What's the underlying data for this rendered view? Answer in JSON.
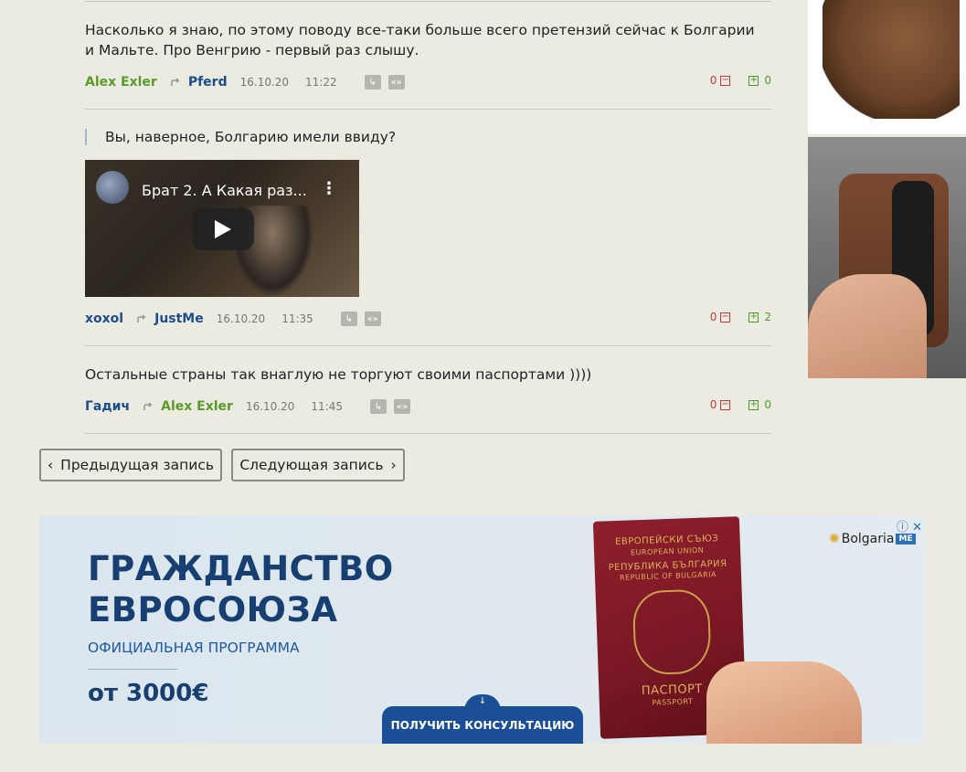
{
  "comments": [
    {
      "text": "Насколько я знаю, по этому поводу все-таки больше всего претензий сейчас к Болгарии и Мальте. Про Венгрию - первый раз слышу.",
      "author": "Alex Exler",
      "reply_to": "Pferd",
      "date": "16.10.20",
      "time": "11:22",
      "minus": "0",
      "plus": "0"
    },
    {
      "quote": "Вы, наверное, Болгарию имели ввиду?",
      "video_title": "Брат 2. А Какая раз...",
      "author": "xoxol",
      "reply_to": "JustMe",
      "date": "16.10.20",
      "time": "11:35",
      "minus": "0",
      "plus": "2"
    },
    {
      "text": "Остальные страны так внаглую не торгуют своими паспортами ))))",
      "author": "Гадич",
      "reply_to": "Alex Exler",
      "date": "16.10.20",
      "time": "11:45",
      "minus": "0",
      "plus": "0"
    }
  ],
  "nav": {
    "prev": "Предыдущая запись",
    "next": "Следующая запись"
  },
  "ad": {
    "headline_1": "ГРАЖДАНСТВО",
    "headline_2": "ЕВРОСОЮЗА",
    "subtitle": "ОФИЦИАЛЬНАЯ ПРОГРАММА",
    "price": "от 3000€",
    "cta": "ПОЛУЧИТЬ КОНСУЛЬТАЦИЮ",
    "brand": "Bolgaria",
    "brand_badge": "ME",
    "passport_lines": [
      "ЕВРОПЕЙСКИ СЪЮЗ",
      "EUROPEAN UNION",
      "РЕПУБЛИКА БЪЛГАРИЯ",
      "REPUBLIC OF BULGARIA"
    ],
    "passport_word": "ПАСПОРТ",
    "passport_word_en": "PASSPORT"
  },
  "colors": {
    "background": "#ecebe1",
    "author_green": "#5a9a2a",
    "author_blue": "#1c4d8c",
    "ad_navy": "#173f72"
  }
}
